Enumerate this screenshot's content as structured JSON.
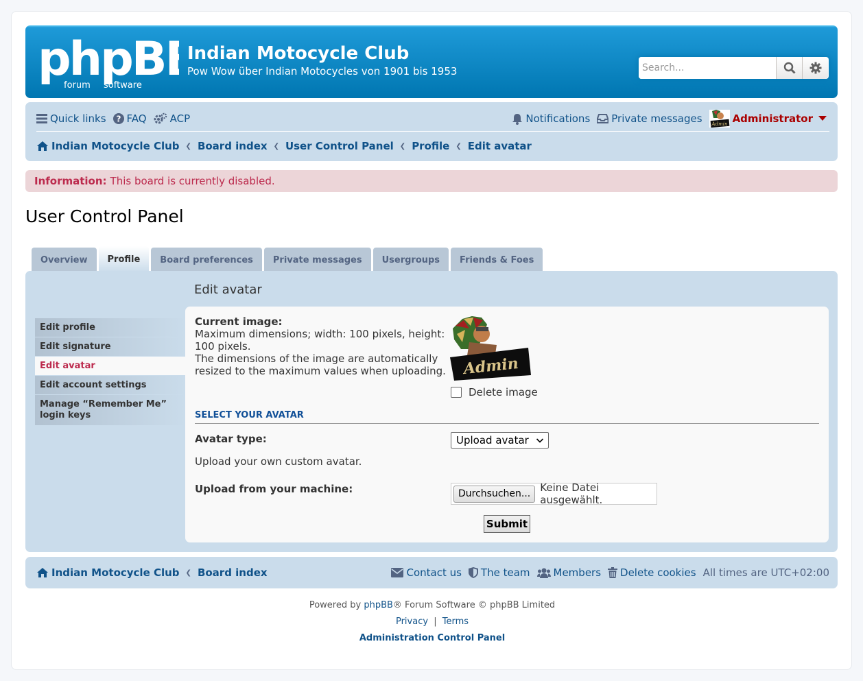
{
  "header": {
    "logo_text": "phpBB",
    "logo_sub": "forum software",
    "site_title": "Indian Motocycle Club",
    "site_description": "Pow Wow über Indian Motocycles von 1901 bis 1953",
    "search_placeholder": "Search..."
  },
  "navbar": {
    "quick_links": "Quick links",
    "faq": "FAQ",
    "acp": "ACP",
    "notifications": "Notifications",
    "private_messages": "Private messages",
    "username": "Administrator",
    "breadcrumbs": [
      "Indian Motocycle Club",
      "Board index",
      "User Control Panel",
      "Profile",
      "Edit avatar"
    ]
  },
  "info": {
    "label": "Information:",
    "text": "This board is currently disabled."
  },
  "page_title": "User Control Panel",
  "tabs": [
    "Overview",
    "Profile",
    "Board preferences",
    "Private messages",
    "Usergroups",
    "Friends & Foes"
  ],
  "active_tab": "Profile",
  "sidebar": {
    "items": [
      "Edit profile",
      "Edit signature",
      "Edit avatar",
      "Edit account settings",
      "Manage “Remember Me” login keys"
    ],
    "active": "Edit avatar"
  },
  "panel": {
    "title": "Edit avatar",
    "current_image_label": "Current image:",
    "current_image_desc1": "Maximum dimensions; width: 100 pixels, height: 100 pixels.",
    "current_image_desc2": "The dimensions of the image are automatically resized to the maximum values when uploading.",
    "avatar_caption": "Admin",
    "delete_image": "Delete image",
    "section_title": "SELECT YOUR AVATAR",
    "avatar_type_label": "Avatar type:",
    "avatar_type_value": "Upload avatar",
    "upload_desc": "Upload your own custom avatar.",
    "upload_label": "Upload from your machine:",
    "browse_button": "Durchsuchen...",
    "no_file": "Keine Datei ausgewählt.",
    "submit": "Submit"
  },
  "footer": {
    "crumbs": [
      "Indian Motocycle Club",
      "Board index"
    ],
    "contact": "Contact us",
    "team": "The team",
    "members": "Members",
    "delete_cookies": "Delete cookies",
    "timezone": "All times are UTC+02:00",
    "powered_prefix": "Powered by",
    "powered_link": "phpBB",
    "powered_suffix": "® Forum Software © phpBB Limited",
    "privacy": "Privacy",
    "pipe": "|",
    "terms": "Terms",
    "acp_link": "Administration Control Panel"
  },
  "colors": {
    "header_blue": "#0076b1",
    "nav_bg": "#cadceb",
    "link": "#105289",
    "info_bg": "#ecd5d8",
    "info_text": "#bc2a4d",
    "admin_red": "#aa0000"
  }
}
